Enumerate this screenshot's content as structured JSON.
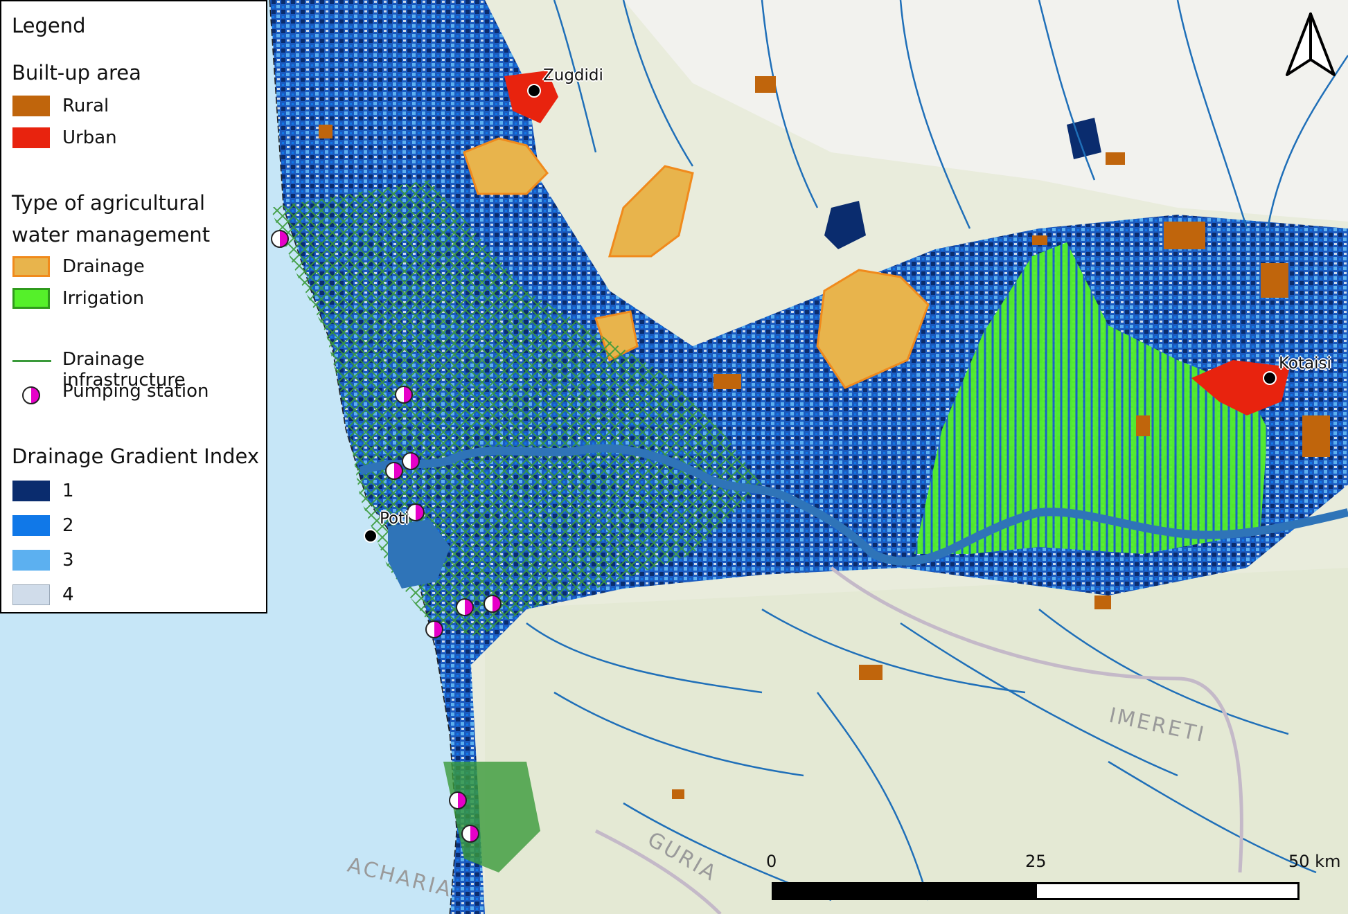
{
  "legend": {
    "title": "Legend",
    "builtup_heading": "Built-up area",
    "builtup_items": [
      {
        "label": "Rural",
        "color": "#c0650c"
      },
      {
        "label": "Urban",
        "color": "#e8230e"
      }
    ],
    "agri_heading_line1": "Type of agricultural",
    "agri_heading_line2": "water management",
    "agri_items": [
      {
        "label": "Drainage",
        "fill": "#e8b44c",
        "stroke": "#f08a1c"
      },
      {
        "label": "Irrigation",
        "fill": "#55f02a",
        "stroke": "#2f9a1c"
      }
    ],
    "infra_label": "Drainage infrastructure",
    "infra_color": "#3a9a3a",
    "pump_label": "Pumping station",
    "dgi_heading": "Drainage Gradient Index",
    "dgi_items": [
      {
        "label": "1",
        "color": "#0a2c6e"
      },
      {
        "label": "2",
        "color": "#1078e8"
      },
      {
        "label": "3",
        "color": "#5cb0f0"
      },
      {
        "label": "4",
        "color": "#d0dcea"
      }
    ]
  },
  "cities": [
    "Zugdidi",
    "Poti",
    "Kotaisi"
  ],
  "regions": [
    "IMERETI",
    "GURIA",
    "ACHARIA"
  ],
  "scalebar": {
    "labels": [
      "0",
      "25",
      "50 km"
    ]
  },
  "colors": {
    "sea": "#c6e6f7",
    "land": "#e9ecdc",
    "river": "#1f6fb8",
    "dgi1": "#0a2c6e",
    "dgi2": "#1078e8",
    "dgi3": "#5cb0f0",
    "dgi4": "#d0dcea",
    "irrigation": "#55f02a",
    "drainage_area": "#e8b44c",
    "infrastructure": "#3a9a3a",
    "rural": "#c0650c",
    "urban": "#e8230e"
  }
}
